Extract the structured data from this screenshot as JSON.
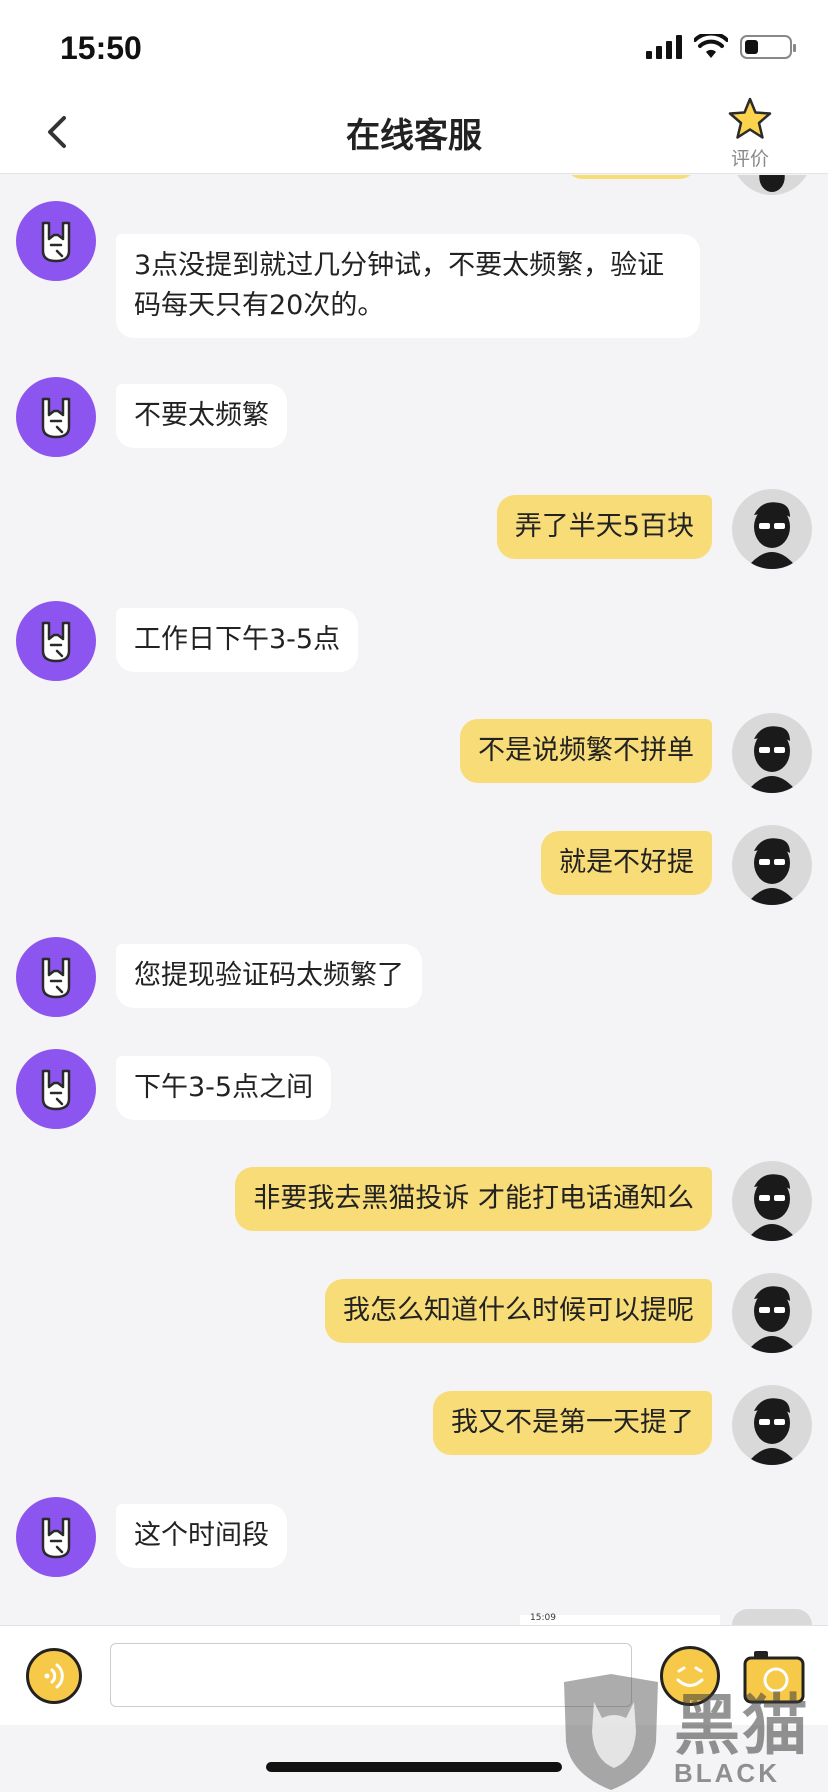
{
  "status_bar": {
    "time": "15:50"
  },
  "nav": {
    "title": "在线客服",
    "rate_label": "评价"
  },
  "messages": [
    {
      "sender": "service",
      "text": "3点没提到就过几分钟试，不要太频繁，验证码每天只有20次的。"
    },
    {
      "sender": "service",
      "text": "不要太频繁"
    },
    {
      "sender": "user",
      "text": "弄了半天5百块"
    },
    {
      "sender": "service",
      "text": "工作日下午3-5点"
    },
    {
      "sender": "user",
      "text": "不是说频繁不拼单"
    },
    {
      "sender": "user",
      "text": "就是不好提"
    },
    {
      "sender": "service",
      "text": "您提现验证码太频繁了"
    },
    {
      "sender": "service",
      "text": "下午3-5点之间"
    },
    {
      "sender": "user",
      "text": "非要我去黑猫投诉 才能打电话通知么"
    },
    {
      "sender": "user",
      "text": "我怎么知道什么时候可以提呢"
    },
    {
      "sender": "user",
      "text": "我又不是第一天提了"
    },
    {
      "sender": "service",
      "text": "这个时间段"
    }
  ],
  "partial_screenshot_time": "15:09",
  "input": {
    "value": ""
  },
  "watermark": {
    "cn": "黑猫",
    "en": "BLACK CAT"
  },
  "colors": {
    "user_bubble": "#f8dc78",
    "service_avatar": "#8d55f0",
    "accent": "#f7c948"
  },
  "icons": [
    "back-chevron-icon",
    "star-icon",
    "voice-icon",
    "emoji-icon",
    "camera-icon",
    "rock-hand-icon",
    "user-sunglasses-icon"
  ]
}
